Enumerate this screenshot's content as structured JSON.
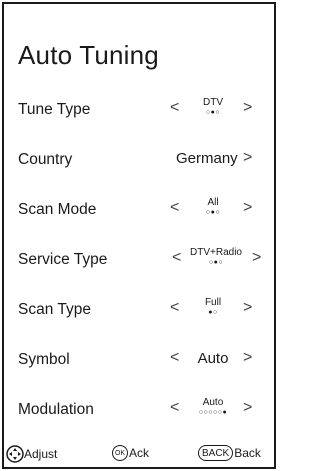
{
  "title": "Auto Tuning",
  "rows": [
    {
      "label": "Tune Type",
      "value": "DTV",
      "dots": "○●○"
    },
    {
      "label": "Country",
      "value": "Germany",
      "dots": ""
    },
    {
      "label": "Scan Mode",
      "value": "All",
      "dots": "○●○"
    },
    {
      "label": "Service Type",
      "value": "DTV+Radio",
      "dots": "○●○"
    },
    {
      "label": "Scan Type",
      "value": "Full",
      "dots": "●○"
    },
    {
      "label": "Symbol",
      "value": "Auto",
      "dots": ""
    },
    {
      "label": "Modulation",
      "value": "Auto",
      "dots": "○○○○○●"
    }
  ],
  "arrows": {
    "left": "<",
    "right": ">"
  },
  "footer": {
    "adjust_label": "Adjust",
    "ok_icon_text": "OK",
    "ack_label": "Ack",
    "back_icon_text": "BACK",
    "back_label": "Back"
  }
}
